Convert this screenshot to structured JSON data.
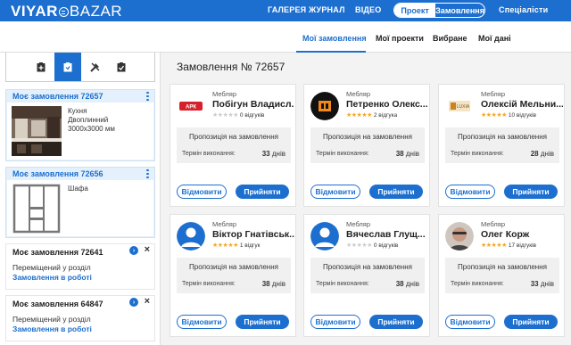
{
  "header": {
    "logo_left": "VIYAR",
    "logo_right": "BAZAR",
    "nav": [
      "ГАЛЕРЕЯ",
      "ЖУРНАЛ",
      "ВІДЕО"
    ],
    "segment": [
      "Проект",
      "Замовлення"
    ],
    "specialists": "Спеціалісти"
  },
  "subtabs": [
    "Мої замовлення",
    "Мої проекти",
    "Вибране",
    "Мої дані"
  ],
  "sidebar": {
    "orders": [
      {
        "title": "Моє замовлення 72657",
        "type": "Кухня",
        "layout": "Двоплинний",
        "size": "3000x3000 мм"
      },
      {
        "title": "Моє замовлення 72656",
        "type": "Шафа"
      },
      {
        "title": "Моє замовлення 72641",
        "moved": "Переміщений у розділ",
        "status": "Замовлення в роботі"
      },
      {
        "title": "Моє замовлення 64847",
        "moved": "Переміщений у розділ",
        "status": "Замовлення в роботі"
      }
    ]
  },
  "main": {
    "title": "Замовлення № 72657",
    "proposal_label": "Пропозиція на замовлення",
    "term_label": "Термін виконання:",
    "days_unit": "днів",
    "decline": "Відмовити",
    "accept": "Прийняти",
    "cards": [
      {
        "role": "Мебляр",
        "name": "Побігун Владисл...",
        "rating": 0,
        "reviews": "0 відгуків",
        "days": "33"
      },
      {
        "role": "Мебляр",
        "name": "Петренко Олекс...",
        "rating": 5,
        "reviews": "2 відгука",
        "days": "38"
      },
      {
        "role": "Мебляр",
        "name": "Олексій Мельни...",
        "rating": 5,
        "reviews": "10 відгуків",
        "days": "28"
      },
      {
        "role": "Мебляр",
        "name": "Віктор Гнатівськ...",
        "rating": 5,
        "reviews": "1 відгук",
        "days": "38"
      },
      {
        "role": "Мебляр",
        "name": "Вячеслав Глущ...",
        "rating": 0,
        "reviews": "0 відгуків",
        "days": "38"
      },
      {
        "role": "Мебляр",
        "name": "Олег Корж",
        "rating": 5,
        "reviews": "17 відгуків",
        "days": "33"
      }
    ]
  },
  "colors": {
    "accent": "#1d6fcf",
    "star": "#f5a623"
  }
}
